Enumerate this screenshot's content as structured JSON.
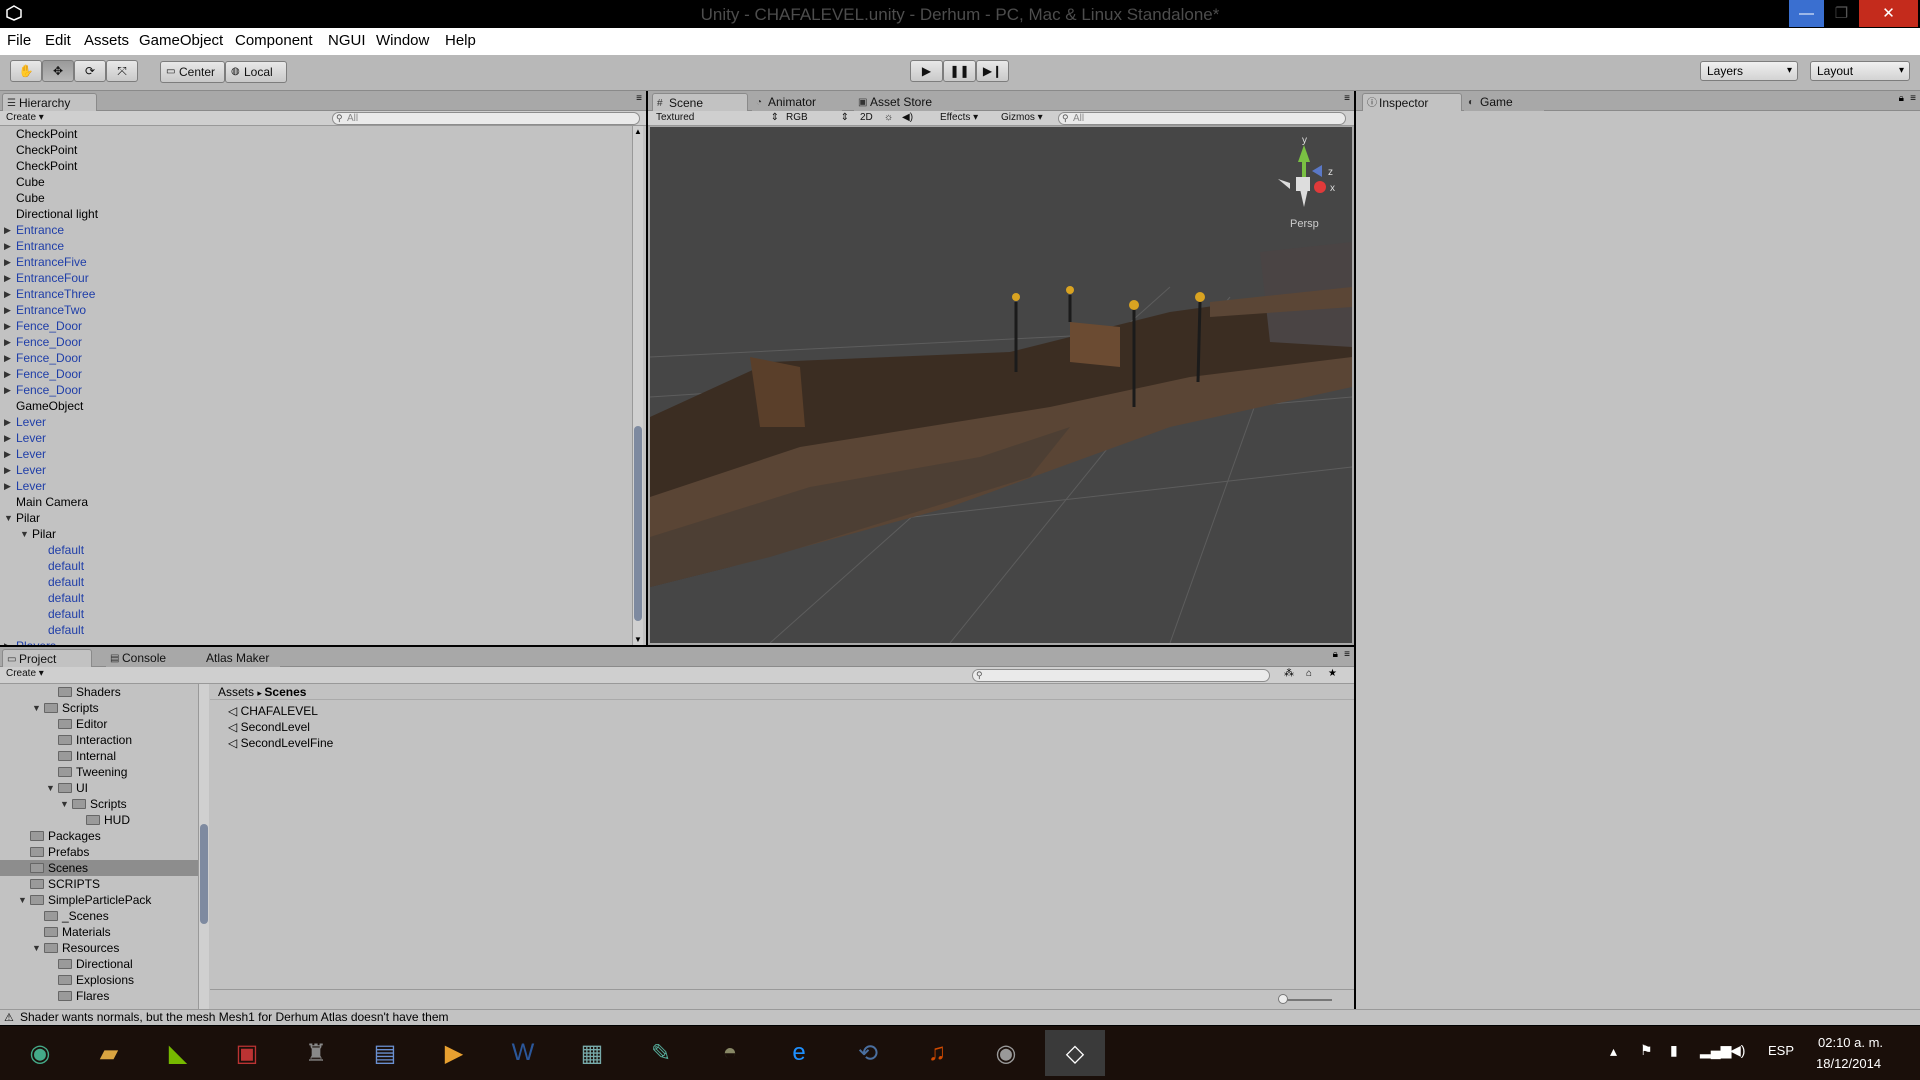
{
  "window": {
    "title": "Unity - CHAFALEVEL.unity - Derhum - PC, Mac & Linux Standalone*"
  },
  "menu": [
    "File",
    "Edit",
    "Assets",
    "GameObject",
    "Component",
    "NGUI",
    "Window",
    "Help"
  ],
  "toolbar": {
    "pivot_label": "Center",
    "space_label": "Local",
    "layers_label": "Layers",
    "layout_label": "Layout"
  },
  "hierarchy": {
    "tab": "Hierarchy",
    "create": "Create",
    "search_placeholder": "All",
    "rows": [
      {
        "label": "CheckPoint",
        "prefab": false,
        "indent": 0,
        "arrow": ""
      },
      {
        "label": "CheckPoint",
        "prefab": false,
        "indent": 0,
        "arrow": ""
      },
      {
        "label": "CheckPoint",
        "prefab": false,
        "indent": 0,
        "arrow": ""
      },
      {
        "label": "Cube",
        "prefab": false,
        "indent": 0,
        "arrow": ""
      },
      {
        "label": "Cube",
        "prefab": false,
        "indent": 0,
        "arrow": ""
      },
      {
        "label": "Directional light",
        "prefab": false,
        "indent": 0,
        "arrow": ""
      },
      {
        "label": "Entrance",
        "prefab": true,
        "indent": 0,
        "arrow": "right"
      },
      {
        "label": "Entrance",
        "prefab": true,
        "indent": 0,
        "arrow": "right"
      },
      {
        "label": "EntranceFive",
        "prefab": true,
        "indent": 0,
        "arrow": "right"
      },
      {
        "label": "EntranceFour",
        "prefab": true,
        "indent": 0,
        "arrow": "right"
      },
      {
        "label": "EntranceThree",
        "prefab": true,
        "indent": 0,
        "arrow": "right"
      },
      {
        "label": "EntranceTwo",
        "prefab": true,
        "indent": 0,
        "arrow": "right"
      },
      {
        "label": "Fence_Door",
        "prefab": true,
        "indent": 0,
        "arrow": "right"
      },
      {
        "label": "Fence_Door",
        "prefab": true,
        "indent": 0,
        "arrow": "right"
      },
      {
        "label": "Fence_Door",
        "prefab": true,
        "indent": 0,
        "arrow": "right"
      },
      {
        "label": "Fence_Door",
        "prefab": true,
        "indent": 0,
        "arrow": "right"
      },
      {
        "label": "Fence_Door",
        "prefab": true,
        "indent": 0,
        "arrow": "right"
      },
      {
        "label": "GameObject",
        "prefab": false,
        "indent": 0,
        "arrow": ""
      },
      {
        "label": "Lever",
        "prefab": true,
        "indent": 0,
        "arrow": "right"
      },
      {
        "label": "Lever",
        "prefab": true,
        "indent": 0,
        "arrow": "right"
      },
      {
        "label": "Lever",
        "prefab": true,
        "indent": 0,
        "arrow": "right"
      },
      {
        "label": "Lever",
        "prefab": true,
        "indent": 0,
        "arrow": "right"
      },
      {
        "label": "Lever",
        "prefab": true,
        "indent": 0,
        "arrow": "right"
      },
      {
        "label": "Main Camera",
        "prefab": false,
        "indent": 0,
        "arrow": ""
      },
      {
        "label": "Pilar",
        "prefab": false,
        "indent": 0,
        "arrow": "down"
      },
      {
        "label": "Pilar",
        "prefab": false,
        "indent": 1,
        "arrow": "down"
      },
      {
        "label": "default",
        "prefab": true,
        "indent": 2,
        "arrow": ""
      },
      {
        "label": "default",
        "prefab": true,
        "indent": 2,
        "arrow": ""
      },
      {
        "label": "default",
        "prefab": true,
        "indent": 2,
        "arrow": ""
      },
      {
        "label": "default",
        "prefab": true,
        "indent": 2,
        "arrow": ""
      },
      {
        "label": "default",
        "prefab": true,
        "indent": 2,
        "arrow": ""
      },
      {
        "label": "default",
        "prefab": true,
        "indent": 2,
        "arrow": ""
      },
      {
        "label": "Players",
        "prefab": true,
        "indent": 0,
        "arrow": "right"
      }
    ]
  },
  "scene": {
    "tabs": [
      "Scene",
      "Animator",
      "Asset Store"
    ],
    "render_mode": "Textured",
    "channel": "RGB",
    "mode_2d": "2D",
    "effects": "Effects",
    "gizmos": "Gizmos",
    "search_placeholder": "All",
    "gizmo_y": "y",
    "gizmo_z": "z",
    "gizmo_x": "x",
    "persp": "Persp"
  },
  "inspector": {
    "tabs": [
      "Inspector",
      "Game"
    ]
  },
  "bottom_tabs": [
    "Project",
    "Console",
    "Atlas Maker"
  ],
  "project": {
    "create": "Create",
    "breadcrumb": [
      "Assets",
      "Scenes"
    ],
    "tree": [
      {
        "label": "Shaders",
        "depth": 2,
        "arrow": ""
      },
      {
        "label": "Scripts",
        "depth": 1,
        "arrow": "down"
      },
      {
        "label": "Editor",
        "depth": 2,
        "arrow": ""
      },
      {
        "label": "Interaction",
        "depth": 2,
        "arrow": ""
      },
      {
        "label": "Internal",
        "depth": 2,
        "arrow": ""
      },
      {
        "label": "Tweening",
        "depth": 2,
        "arrow": ""
      },
      {
        "label": "UI",
        "depth": 2,
        "arrow": "down"
      },
      {
        "label": "Scripts",
        "depth": 3,
        "arrow": "down"
      },
      {
        "label": "HUD",
        "depth": 4,
        "arrow": ""
      },
      {
        "label": "Packages",
        "depth": 0,
        "arrow": ""
      },
      {
        "label": "Prefabs",
        "depth": 0,
        "arrow": ""
      },
      {
        "label": "Scenes",
        "depth": 0,
        "arrow": "",
        "selected": true
      },
      {
        "label": "SCRIPTS",
        "depth": 0,
        "arrow": ""
      },
      {
        "label": "SimpleParticlePack",
        "depth": 0,
        "arrow": "down"
      },
      {
        "label": "_Scenes",
        "depth": 1,
        "arrow": ""
      },
      {
        "label": "Materials",
        "depth": 1,
        "arrow": ""
      },
      {
        "label": "Resources",
        "depth": 1,
        "arrow": "down"
      },
      {
        "label": "Directional",
        "depth": 2,
        "arrow": ""
      },
      {
        "label": "Explosions",
        "depth": 2,
        "arrow": ""
      },
      {
        "label": "Flares",
        "depth": 2,
        "arrow": ""
      }
    ],
    "files": [
      "CHAFALEVEL",
      "SecondLevel",
      "SecondLevelFine"
    ]
  },
  "status": {
    "message": "Shader wants normals, but the mesh Mesh1 for Derhum Atlas doesn't have them"
  },
  "taskbar": {
    "language": "ESP",
    "time": "02:10 a. m.",
    "date": "18/12/2014",
    "apps": [
      "chrome-icon",
      "file-explorer-icon",
      "nvidia-icon",
      "dirt3-icon",
      "game-of-thrones-icon",
      "notepad-icon",
      "media-player-icon",
      "word-icon",
      "picture-viewer-icon",
      "paint-icon",
      "gimp-icon",
      "internet-explorer-icon",
      "sync-icon",
      "audacity-icon",
      "speaker-icon",
      "unity-icon"
    ]
  },
  "colors": {
    "panel": "#c2c2c2",
    "prefab_text": "#1f3ea8",
    "scene_bg": "#464646",
    "taskbar": "#1a0f0a"
  }
}
